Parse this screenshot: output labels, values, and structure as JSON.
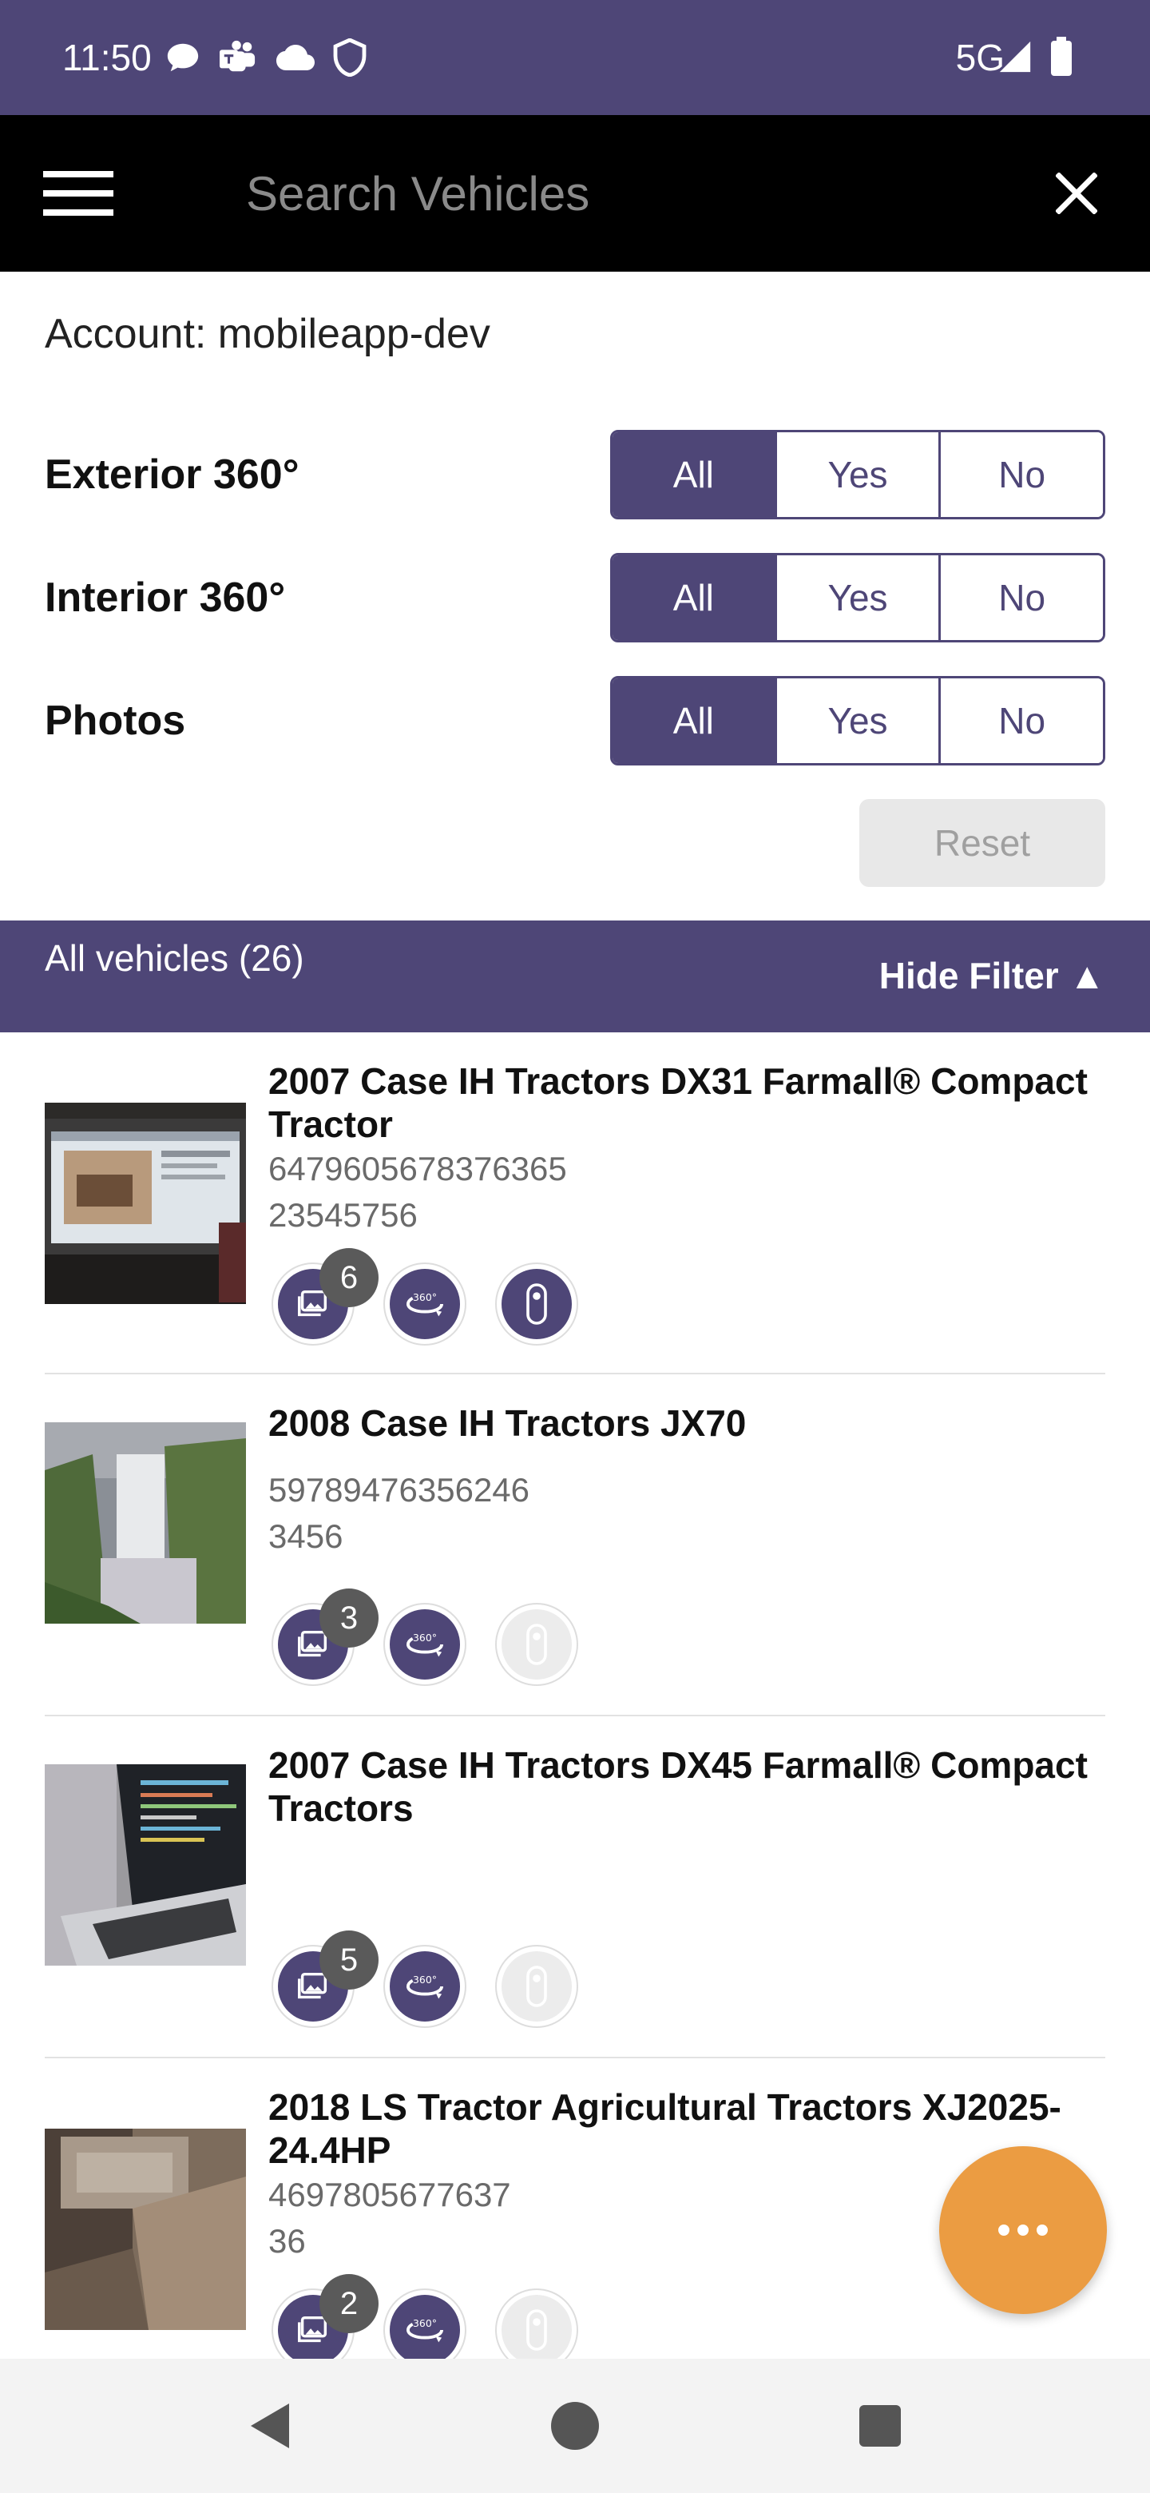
{
  "status_bar": {
    "time": "11:50",
    "network": "5G",
    "icons": [
      "chat-bubble-icon",
      "teams-icon",
      "cloud-icon",
      "shield-icon",
      "signal-icon",
      "battery-icon"
    ]
  },
  "search": {
    "placeholder": "Search Vehicles",
    "value": ""
  },
  "account": {
    "label": "Account: mobileapp-dev"
  },
  "filters": [
    {
      "label": "Exterior 360°",
      "options": [
        "All",
        "Yes",
        "No"
      ],
      "selected": "All"
    },
    {
      "label": "Interior 360°",
      "options": [
        "All",
        "Yes",
        "No"
      ],
      "selected": "All"
    },
    {
      "label": "Photos",
      "options": [
        "All",
        "Yes",
        "No"
      ],
      "selected": "All"
    }
  ],
  "reset_label": "Reset",
  "results": {
    "count_label": "All vehicles (26)",
    "hide_filter_label": "Hide Filter ▲"
  },
  "vehicles": [
    {
      "title": "2007 Case IH Tractors DX31 Farmall® Compact Tractor",
      "line1": "6479605678376365",
      "line2": "23545756",
      "photo_count": "6",
      "exterior_360": true,
      "interior_360": true
    },
    {
      "title": "2008 Case IH Tractors JX70",
      "line1": "59789476356246",
      "line2": "3456",
      "photo_count": "3",
      "exterior_360": true,
      "interior_360": false
    },
    {
      "title": "2007 Case IH Tractors DX45 Farmall® Compact Tractors",
      "line1": "",
      "line2": "",
      "photo_count": "5",
      "exterior_360": true,
      "interior_360": false
    },
    {
      "title": "2018 LS Tractor Agricultural Tractors XJ2025-24.4HP",
      "line1": "4697805677637",
      "line2": "36",
      "photo_count": "2",
      "exterior_360": true,
      "interior_360": false
    }
  ],
  "colors": {
    "brand": "#4e4677",
    "fab": "#eb9c42",
    "toolbar": "#000000"
  }
}
